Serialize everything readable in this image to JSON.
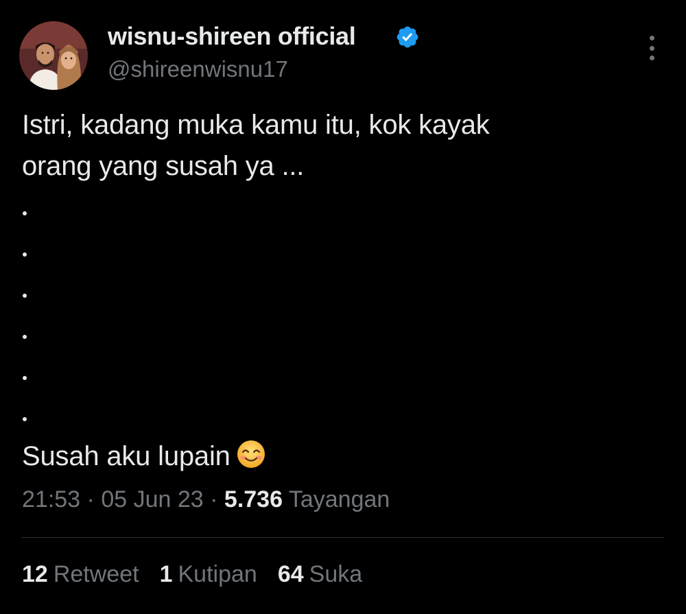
{
  "author": {
    "display_name": "wisnu-shireen official",
    "handle": "@shireenwisnu17",
    "verified": true,
    "verified_icon": "verified-badge-icon",
    "avatar_icon": "profile-photo"
  },
  "tweet": {
    "line1": "Istri, kadang muka kamu itu, kok kayak",
    "line2": "orang yang susah ya ...",
    "dots": [
      ".",
      ".",
      ".",
      ".",
      ".",
      "."
    ],
    "closing": "Susah aku lupain",
    "emoji": "smiling-face-with-smiling-eyes"
  },
  "meta": {
    "time": "21:53",
    "date": "05 Jun 23",
    "views_count": "5.736",
    "views_label": "Tayangan",
    "separator": "·"
  },
  "stats": {
    "retweets_count": "12",
    "retweets_label": "Retweet",
    "quotes_count": "1",
    "quotes_label": "Kutipan",
    "likes_count": "64",
    "likes_label": "Suka"
  },
  "colors": {
    "background": "#000000",
    "text": "#e7e9ea",
    "secondary": "#71767b",
    "verified": "#1d9bf0",
    "divider": "#2f3336"
  }
}
